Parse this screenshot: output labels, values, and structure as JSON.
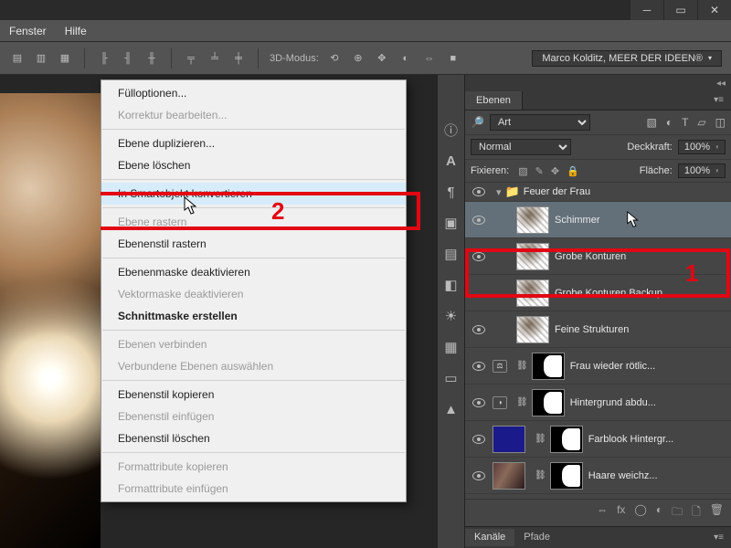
{
  "menubar": {
    "item1": "Fenster",
    "item2": "Hilfe"
  },
  "optionsbar": {
    "mode3d_label": "3D-Modus:",
    "branding": "Marco Kolditz, MEER DER IDEEN®"
  },
  "context_menu": {
    "fill_options": "Fülloptionen...",
    "edit_adjustment": "Korrektur bearbeiten...",
    "duplicate_layer": "Ebene duplizieren...",
    "delete_layer": "Ebene löschen",
    "convert_smart_object": "In Smartobjekt konvertieren",
    "rasterize_layer": "Ebene rastern",
    "rasterize_style": "Ebenenstil rastern",
    "disable_layer_mask": "Ebenenmaske deaktivieren",
    "disable_vector_mask": "Vektormaske deaktivieren",
    "create_clipping_mask": "Schnittmaske erstellen",
    "link_layers": "Ebenen verbinden",
    "select_linked": "Verbundene Ebenen auswählen",
    "copy_style": "Ebenenstil kopieren",
    "paste_style": "Ebenenstil einfügen",
    "clear_style": "Ebenenstil löschen",
    "copy_format_attrs": "Formattribute kopieren",
    "paste_format_attrs": "Formattribute einfügen"
  },
  "annotations": {
    "label1": "1",
    "label2": "2"
  },
  "layers_panel": {
    "tab_label": "Ebenen",
    "filter_type": "Art",
    "blend_mode": "Normal",
    "opacity_label": "Deckkraft:",
    "opacity_value": "100%",
    "lock_label": "Fixieren:",
    "fill_label": "Fläche:",
    "fill_value": "100%",
    "group_name": "Feuer der Frau",
    "layers": [
      {
        "name": "Schimmer"
      },
      {
        "name": "Grobe Konturen"
      },
      {
        "name": "Grobe Konturen Backup"
      },
      {
        "name": "Feine Strukturen"
      },
      {
        "name": "Frau wieder rötlic..."
      },
      {
        "name": "Hintergrund abdu..."
      },
      {
        "name": "Farblook Hintergr..."
      },
      {
        "name": "Haare weichz..."
      }
    ],
    "bottom_tabs": {
      "channels": "Kanäle",
      "paths": "Pfade"
    }
  }
}
